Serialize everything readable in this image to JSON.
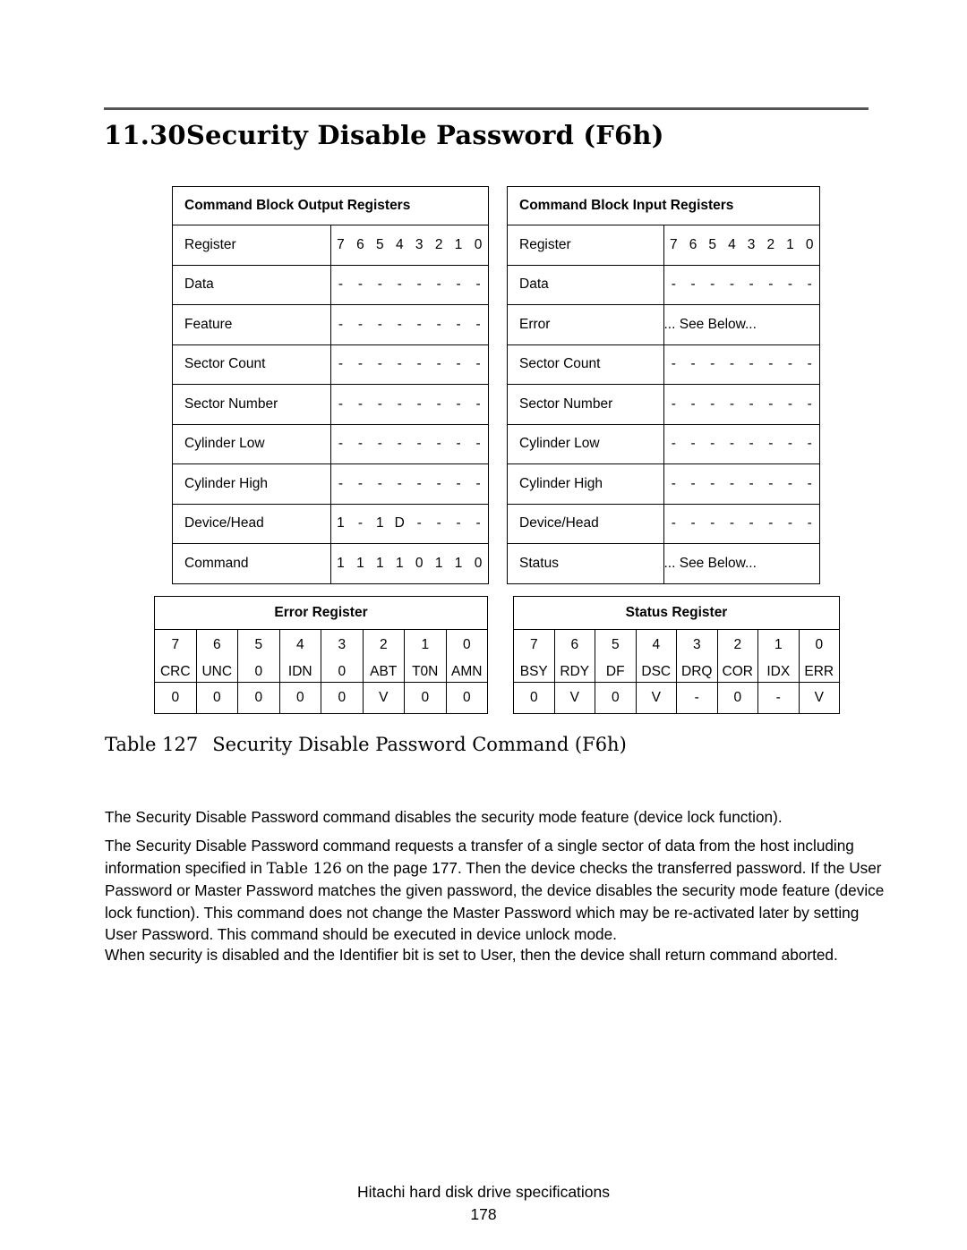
{
  "heading": {
    "number": "11.30",
    "title": "Security Disable Password (F6h)"
  },
  "output_registers": {
    "title": "Command Block Output Registers",
    "bit_header_label": "Register",
    "bit_numbers": [
      "7",
      "6",
      "5",
      "4",
      "3",
      "2",
      "1",
      "0"
    ],
    "rows": [
      {
        "label": "Data",
        "bits": [
          "-",
          "-",
          "-",
          "-",
          "-",
          "-",
          "-",
          "-"
        ]
      },
      {
        "label": "Feature",
        "bits": [
          "-",
          "-",
          "-",
          "-",
          "-",
          "-",
          "-",
          "-"
        ]
      },
      {
        "label": "Sector Count",
        "bits": [
          "-",
          "-",
          "-",
          "-",
          "-",
          "-",
          "-",
          "-"
        ]
      },
      {
        "label": "Sector Number",
        "bits": [
          "-",
          "-",
          "-",
          "-",
          "-",
          "-",
          "-",
          "-"
        ]
      },
      {
        "label": "Cylinder Low",
        "bits": [
          "-",
          "-",
          "-",
          "-",
          "-",
          "-",
          "-",
          "-"
        ]
      },
      {
        "label": "Cylinder High",
        "bits": [
          "-",
          "-",
          "-",
          "-",
          "-",
          "-",
          "-",
          "-"
        ]
      },
      {
        "label": "Device/Head",
        "bits": [
          "1",
          "-",
          "1",
          "D",
          "-",
          "-",
          "-",
          "-"
        ]
      },
      {
        "label": "Command",
        "bits": [
          "1",
          "1",
          "1",
          "1",
          "0",
          "1",
          "1",
          "0"
        ]
      }
    ]
  },
  "input_registers": {
    "title": "Command Block Input Registers",
    "bit_header_label": "Register",
    "bit_numbers": [
      "7",
      "6",
      "5",
      "4",
      "3",
      "2",
      "1",
      "0"
    ],
    "see_below_text": "... See Below...",
    "rows": [
      {
        "label": "Data",
        "bits": [
          "-",
          "-",
          "-",
          "-",
          "-",
          "-",
          "-",
          "-"
        ]
      },
      {
        "label": "Error",
        "span": true
      },
      {
        "label": "Sector Count",
        "bits": [
          "-",
          "-",
          "-",
          "-",
          "-",
          "-",
          "-",
          "-"
        ]
      },
      {
        "label": "Sector Number",
        "bits": [
          "-",
          "-",
          "-",
          "-",
          "-",
          "-",
          "-",
          "-"
        ]
      },
      {
        "label": "Cylinder Low",
        "bits": [
          "-",
          "-",
          "-",
          "-",
          "-",
          "-",
          "-",
          "-"
        ]
      },
      {
        "label": "Cylinder High",
        "bits": [
          "-",
          "-",
          "-",
          "-",
          "-",
          "-",
          "-",
          "-"
        ]
      },
      {
        "label": "Device/Head",
        "bits": [
          "-",
          "-",
          "-",
          "-",
          "-",
          "-",
          "-",
          "-"
        ]
      },
      {
        "label": "Status",
        "span": true
      }
    ]
  },
  "error_register": {
    "title": "Error Register",
    "bit_numbers": [
      "7",
      "6",
      "5",
      "4",
      "3",
      "2",
      "1",
      "0"
    ],
    "bit_names": [
      "CRC",
      "UNC",
      "0",
      "IDN",
      "0",
      "ABT",
      "T0N",
      "AMN"
    ],
    "values": [
      "0",
      "0",
      "0",
      "0",
      "0",
      "V",
      "0",
      "0"
    ]
  },
  "status_register": {
    "title": "Status Register",
    "bit_numbers": [
      "7",
      "6",
      "5",
      "4",
      "3",
      "2",
      "1",
      "0"
    ],
    "bit_names": [
      "BSY",
      "RDY",
      "DF",
      "DSC",
      "DRQ",
      "COR",
      "IDX",
      "ERR"
    ],
    "values": [
      "0",
      "V",
      "0",
      "V",
      "-",
      "0",
      "-",
      "V"
    ]
  },
  "caption": {
    "label": "Table 127",
    "text": "Security Disable Password Command (F6h)"
  },
  "paragraphs": {
    "p1": "The Security Disable Password command disables the security mode feature (device lock function).",
    "p2_part1": "The Security Disable Password command requests a transfer of a single sector of data from the host including information specified in ",
    "p2_xref": "Table 126",
    "p2_part2": " on the page 177. Then the device checks the transferred password. If the User Password or Master Password matches the given password, the device disables the security mode feature (device lock function). This command does not change the Master Password which may be re-activated later by setting User Password. This command should be executed in device unlock mode.",
    "p3": "When security is disabled and the Identifier bit is set to User, then the device shall return command aborted."
  },
  "footer": {
    "line1": "Hitachi hard disk drive specifications",
    "page_number": "178"
  },
  "colors": {
    "rule": "#555555",
    "border": "#000000",
    "text": "#000000"
  }
}
